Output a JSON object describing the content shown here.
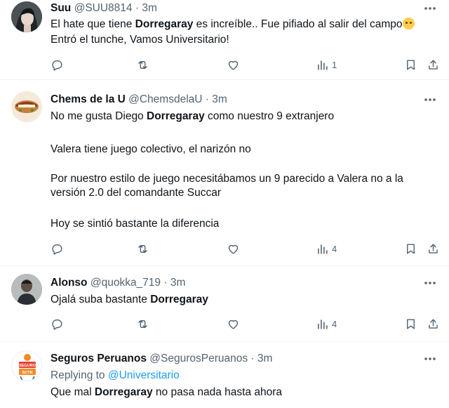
{
  "tweets": [
    {
      "name": "Suu",
      "handle": "@SUU8814",
      "dot": "·",
      "time": "3m",
      "lines": [
        {
          "pre": "El hate que tiene ",
          "bold": "Dorregaray",
          "post": " es increíble.. Fue pifiado al salir del campo"
        },
        {
          "pre": "Entró el tunche, Vamos Universitario!",
          "bold": "",
          "post": ""
        }
      ],
      "views": "1"
    },
    {
      "name": "Chems de la U",
      "handle": "@ChemsdelaU",
      "dot": "·",
      "time": "3m",
      "lines": [
        {
          "pre": "No me gusta Diego ",
          "bold": "Dorregaray",
          "post": " como nuestro 9 extranjero"
        },
        {
          "pre": "Valera tiene juego colectivo, el narizón no",
          "bold": "",
          "post": ""
        },
        {
          "pre": "Por nuestro estilo de juego necesitábamos un 9 parecido a Valera no a la",
          "bold": "",
          "post": ""
        },
        {
          "pre": "versión 2.0 del comandante Succar",
          "bold": "",
          "post": ""
        },
        {
          "pre": "Hoy se sintió bastante la diferencia",
          "bold": "",
          "post": ""
        }
      ],
      "views": "4"
    },
    {
      "name": "Alonso",
      "handle": "@quokka_719",
      "dot": "·",
      "time": "3m",
      "lines": [
        {
          "pre": "Ojalá suba bastante ",
          "bold": "Dorregaray",
          "post": ""
        }
      ],
      "views": "4"
    },
    {
      "name": "Seguros Peruanos",
      "handle": "@SegurosPeruanos",
      "dot": "·",
      "time": "3m",
      "replying_prefix": "Replying to ",
      "replying_to": "@Universitario",
      "lines": [
        {
          "pre": "Que mal ",
          "bold": "Dorregaray",
          "post": " no pasa nada hasta ahora"
        }
      ],
      "avatar_text_top": "SEGURO",
      "avatar_text_bottom": "SCTR"
    }
  ],
  "colors": {
    "text": "#0f1419",
    "secondary": "#536471",
    "link": "#1d9bf0",
    "divider": "#eff3f4"
  }
}
